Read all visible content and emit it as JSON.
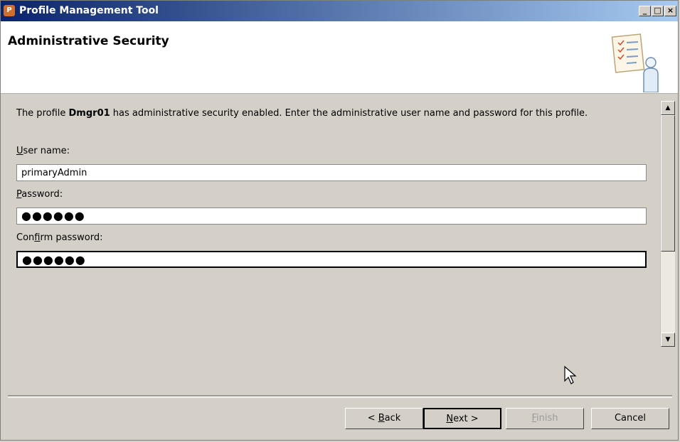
{
  "window": {
    "title": "Profile Management Tool",
    "controls": {
      "minimize": "_",
      "maximize": "□",
      "close": "×"
    }
  },
  "header": {
    "title": "Administrative Security"
  },
  "content": {
    "desc_prefix": "The profile ",
    "profile_name": "Dmgr01",
    "desc_suffix": " has administrative security enabled.  Enter the administrative user name and password for this profile.",
    "user_name_label_first": "U",
    "user_name_label_rest": "ser name:",
    "user_name_value": "primaryAdmin",
    "password_label_first": "P",
    "password_label_rest": "assword:",
    "password_value": "●●●●●●",
    "confirm_label_before": "Con",
    "confirm_label_mnemonic": "f",
    "confirm_label_after": "irm password:",
    "confirm_value": "●●●●●●"
  },
  "footer": {
    "back_prefix": "< ",
    "back_mnemonic": "B",
    "back_rest": "ack",
    "next_mnemonic": "N",
    "next_rest": "ext >",
    "finish_mnemonic": "F",
    "finish_rest": "inish",
    "cancel_label": "Cancel"
  },
  "colors": {
    "titlebar_start": "#0a246a",
    "titlebar_end": "#a6caf0",
    "panel": "#d4d0c8",
    "header_bg": "#ffffff"
  },
  "icons": {
    "app": "profile-tool-icon",
    "banner": "checklist-person-icon",
    "cursor": "mouse-pointer-icon"
  }
}
